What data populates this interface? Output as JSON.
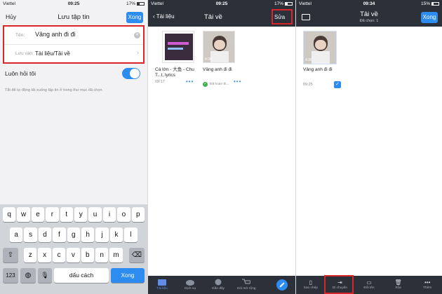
{
  "panel1": {
    "status": {
      "carrier": "Viettel",
      "time": "09:25",
      "battery": "17%"
    },
    "nav": {
      "cancel": "Hủy",
      "title": "Lưu tập tin",
      "done": "Xong"
    },
    "form": {
      "name_label": "Tên:",
      "name_value": "Vâng anh đi đi",
      "folder_label": "Lưu vào:",
      "folder_value": "Tài liệu/Tải về"
    },
    "ask_label": "Luôn hỏi tôi",
    "hint": "Tắt để tự động tải xuống tập tin ở trong thư mục đã chọn.",
    "keyboard": {
      "row1": [
        "q",
        "w",
        "e",
        "r",
        "t",
        "y",
        "u",
        "i",
        "o",
        "p"
      ],
      "row2": [
        "a",
        "s",
        "d",
        "f",
        "g",
        "h",
        "j",
        "k",
        "l"
      ],
      "row3": [
        "z",
        "x",
        "c",
        "v",
        "b",
        "n",
        "m"
      ],
      "numbers": "123",
      "space": "dấu cách",
      "return": "Xong"
    }
  },
  "panel2": {
    "status": {
      "carrier": "Viettel",
      "time": "09:25",
      "battery": "17%"
    },
    "nav": {
      "back": "Tài liệu",
      "title": "Tải về",
      "edit": "Sửa"
    },
    "files": [
      {
        "name": "Cá lớn - 大鱼 - Chu T...t, lyrics",
        "time": "09:17"
      },
      {
        "name": "Vâng anh đi đi",
        "status": "Đã hoàn th...",
        "duration": "4:36"
      }
    ],
    "tabs": [
      "Tài liệu",
      "Dịch vụ",
      "Gần đây",
      "Gói mở rộng"
    ]
  },
  "panel3": {
    "status": {
      "carrier": "Viettel",
      "time": "09:34",
      "battery": "15%"
    },
    "nav": {
      "title": "Tải về",
      "subtitle": "Đã chọn: 1",
      "done": "Xong"
    },
    "file": {
      "name": "Vâng anh đi đi",
      "time": "09:25",
      "duration": "4:36"
    },
    "toolbar": [
      "Sao chép",
      "Di chuyển",
      "Đổi tên",
      "Xóa",
      "Thêm"
    ]
  }
}
